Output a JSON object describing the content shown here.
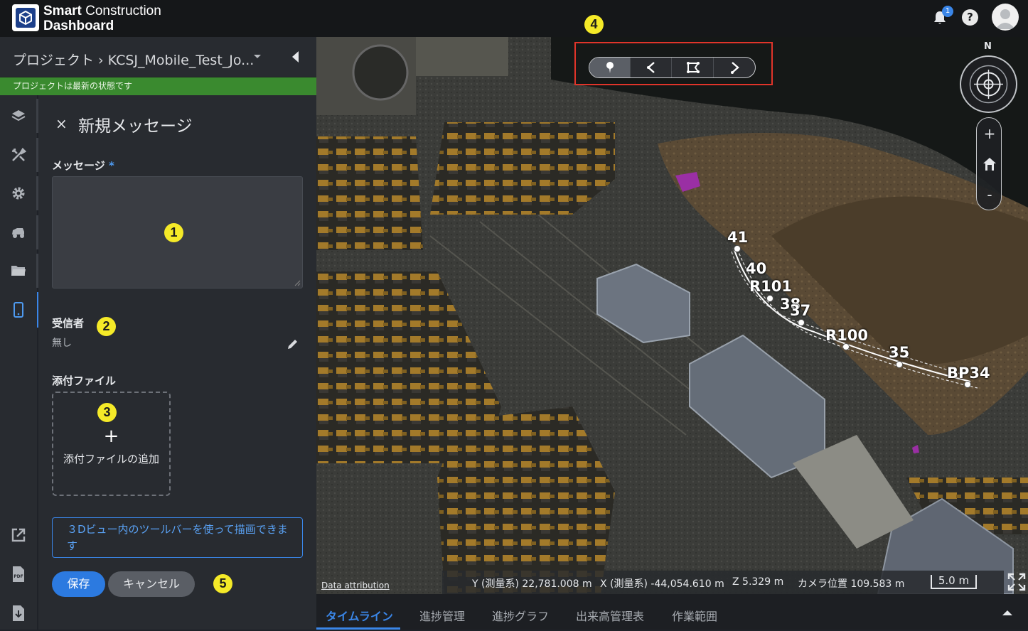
{
  "app": {
    "brand_line1_bold": "Smart",
    "brand_line1_light": "Construction",
    "brand_line2": "Dashboard",
    "notification_count": "1",
    "help_label": "?"
  },
  "breadcrumb": {
    "text": "プロジェクト › KCSJ_Mobile_Test_Jo..."
  },
  "status": {
    "text": "プロジェクトは最新の状態です"
  },
  "rail": {
    "items": [
      "layers-icon",
      "tools-icon",
      "settings-gear-icon",
      "machine-icon",
      "folder-icon",
      "mobile-device-icon",
      "export-icon",
      "pdf-icon",
      "download-file-icon"
    ],
    "active_index": 5
  },
  "panel": {
    "title": "新規メッセージ",
    "close": "×",
    "message_label": "メッセージ",
    "required_mark": "*",
    "recipients_label": "受信者",
    "recipients_value": "無し",
    "attachments_label": "添付ファイル",
    "attach_plus": "+",
    "attach_add": "添付ファイルの追加",
    "info": "３Dビュー内のツールバーを使って描画できます",
    "save": "保存",
    "cancel": "キャンセル"
  },
  "callouts": [
    "1",
    "2",
    "3",
    "4",
    "5"
  ],
  "view": {
    "compass_n": "N",
    "zoom_in": "+",
    "zoom_out": "-",
    "attribution": "Data attribution",
    "coord_y": "Y (測量系) 22,781.008 m",
    "coord_x": "X (測量系) -44,054.610 m",
    "coord_z": "Z 5.329 m",
    "camera": "カメラ位置 109.583 m",
    "scale": "5.0 m",
    "stations": [
      "41",
      "40",
      "R101",
      "38",
      "37",
      "R100",
      "35",
      "BP34"
    ]
  },
  "bottom_tabs": [
    "タイムライン",
    "進捗管理",
    "進捗グラフ",
    "出来高管理表",
    "作業範囲"
  ],
  "bottom_active": 0
}
